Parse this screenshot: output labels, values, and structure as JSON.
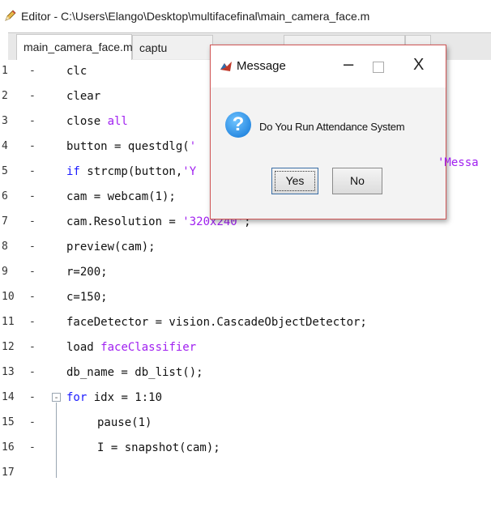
{
  "window": {
    "title": "Editor - C:\\Users\\Elango\\Desktop\\multifacefinal\\main_camera_face.m"
  },
  "tabs": [
    {
      "label": "main_camera_face.m",
      "close": "✕"
    },
    {
      "label": "captu"
    },
    {
      "label": ""
    },
    {
      "label": ""
    }
  ],
  "lines": [
    {
      "n": "1",
      "dash": "-",
      "parts": [
        {
          "t": "clc"
        }
      ]
    },
    {
      "n": "2",
      "dash": "-",
      "parts": [
        {
          "t": "clear"
        }
      ]
    },
    {
      "n": "3",
      "dash": "-",
      "parts": [
        {
          "t": "close "
        },
        {
          "t": "all",
          "c": "str"
        }
      ]
    },
    {
      "n": "4",
      "dash": "-",
      "parts": [
        {
          "t": "button = questdlg("
        },
        {
          "t": "'",
          "c": "str"
        }
      ]
    },
    {
      "n": "5",
      "dash": "-",
      "parts": [
        {
          "t": "if",
          "c": "kw"
        },
        {
          "t": " strcmp(button,"
        },
        {
          "t": "'Y",
          "c": "str"
        }
      ]
    },
    {
      "n": "6",
      "dash": "-",
      "parts": [
        {
          "t": "cam = webcam(1);"
        }
      ]
    },
    {
      "n": "7",
      "dash": "-",
      "parts": [
        {
          "t": "cam.Resolution = "
        },
        {
          "t": "'320x240'",
          "c": "str"
        },
        {
          "t": ";"
        }
      ]
    },
    {
      "n": "8",
      "dash": "-",
      "parts": [
        {
          "t": "preview(cam);"
        }
      ]
    },
    {
      "n": "9",
      "dash": "-",
      "parts": [
        {
          "t": "r=200;"
        }
      ]
    },
    {
      "n": "10",
      "dash": "-",
      "parts": [
        {
          "t": "c=150;"
        }
      ]
    },
    {
      "n": "11",
      "dash": "-",
      "parts": [
        {
          "t": "faceDetector = vision.CascadeObjectDetector;"
        }
      ]
    },
    {
      "n": "12",
      "dash": "-",
      "parts": [
        {
          "t": "load "
        },
        {
          "t": "faceClassifier",
          "c": "str"
        }
      ]
    },
    {
      "n": "13",
      "dash": "-",
      "parts": [
        {
          "t": "db_name = db_list();"
        }
      ]
    },
    {
      "n": "14",
      "dash": "-",
      "fold": "-",
      "parts": [
        {
          "t": "for",
          "c": "kw"
        },
        {
          "t": " idx = 1:10"
        }
      ]
    },
    {
      "n": "15",
      "dash": "-",
      "indent": true,
      "parts": [
        {
          "t": "pause(1)"
        }
      ]
    },
    {
      "n": "16",
      "dash": "-",
      "indent": true,
      "parts": [
        {
          "t": "I = snapshot(cam);"
        }
      ]
    },
    {
      "n": "17",
      "dash": "",
      "parts": []
    }
  ],
  "stray_text": "'Messa",
  "dialog": {
    "title": "Message",
    "minimize": "–",
    "close": "X",
    "message": "Do You Run Attendance System",
    "question_glyph": "?",
    "yes_label": "Yes",
    "no_label": "No"
  }
}
